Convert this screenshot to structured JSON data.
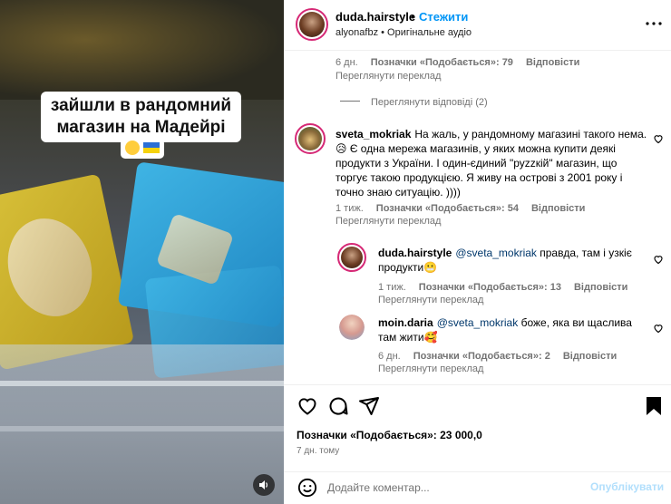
{
  "media": {
    "caption_text": "зайшли в рандомний магазин на Мадейрі",
    "caption_emoji": "😁🇺🇦",
    "mute_icon": "speaker-icon"
  },
  "header": {
    "username": "duda.hairstyle",
    "dot": "•",
    "follow_label": "Стежити",
    "audio": "alyonafbz • Оригінальне аудіо",
    "more_icon": "more-horizontal-icon"
  },
  "comments": {
    "top_meta": {
      "time": "6 дн.",
      "likes": "Позначки «Подобається»: 79",
      "reply": "Відповісти",
      "translate": "Переглянути переклад"
    },
    "view_replies": "Переглянути відповіді (2)",
    "main": {
      "username": "sveta_mokriak",
      "text": "На жаль, у рандомному магазині такого нема. 😥 Є одна мережа магазинів, у яких можна купити деякі продукти з України. І один-єдиний \"руzzкій\" магазин, що торгує такою продукцією. Я живу на острові з 2001 року і точно знаю ситуацію. ))))",
      "time": "1 тиж.",
      "likes": "Позначки «Подобається»: 54",
      "reply": "Відповісти",
      "translate": "Переглянути переклад"
    },
    "replies": [
      {
        "username": "duda.hairstyle",
        "mention": "@sveta_mokriak",
        "text": "правда, там і узкіє продукти😬",
        "time": "1 тиж.",
        "likes": "Позначки «Подобається»: 13",
        "reply": "Відповісти",
        "translate": "Переглянути переклад"
      },
      {
        "username": "moin.daria",
        "mention": "@sveta_mokriak",
        "text": "боже, яка ви щаслива там жити🥰",
        "time": "6 дн.",
        "likes": "Позначки «Подобається»: 2",
        "reply": "Відповісти",
        "translate": "Переглянути переклад"
      }
    ]
  },
  "actions": {
    "likes": "Позначки «Подобається»: 23 000,0",
    "posted": "7 дн. тому"
  },
  "composer": {
    "placeholder": "Додайте коментар...",
    "publish_label": "Опублікувати"
  },
  "colors": {
    "accent": "#0095f6",
    "publish_disabled": "#b2dffc",
    "meta": "#737373",
    "mention": "#00376b"
  }
}
